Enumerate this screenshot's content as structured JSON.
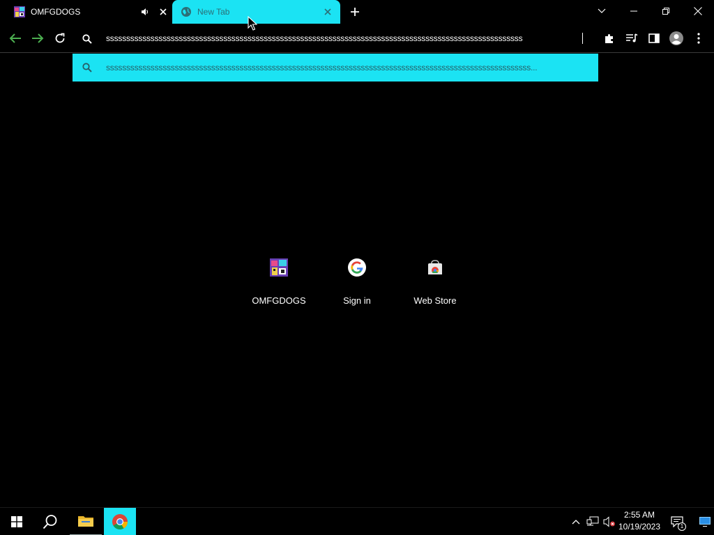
{
  "tabs": [
    {
      "title": "OMFGDOGS",
      "active": false,
      "audio": true
    },
    {
      "title": "New Tab",
      "active": true,
      "audio": false
    }
  ],
  "omnibox": {
    "value": "sssssssssssssssssssssssssssssssssssssssssssssssssssssssssssssssssssssssssssssssssssssssssssssssssssssss"
  },
  "suggestion": {
    "text": "sssssssssssssssssssssssssssssssssssssssssssssssssssssssssssssssssssssssssssssssssssssssssssssssssssssssss..."
  },
  "shortcuts": [
    {
      "label": "OMFGDOGS",
      "icon": "omfgdogs-favicon"
    },
    {
      "label": "Sign in",
      "icon": "google-g-icon"
    },
    {
      "label": "Web Store",
      "icon": "chrome-web-store-icon"
    }
  ],
  "taskbar": {
    "time": "2:55 AM",
    "date": "10/19/2023",
    "notification_count": "1"
  },
  "colors": {
    "accent": "#1be3f3",
    "background": "#000000",
    "nav_arrows": "#4caf50"
  }
}
